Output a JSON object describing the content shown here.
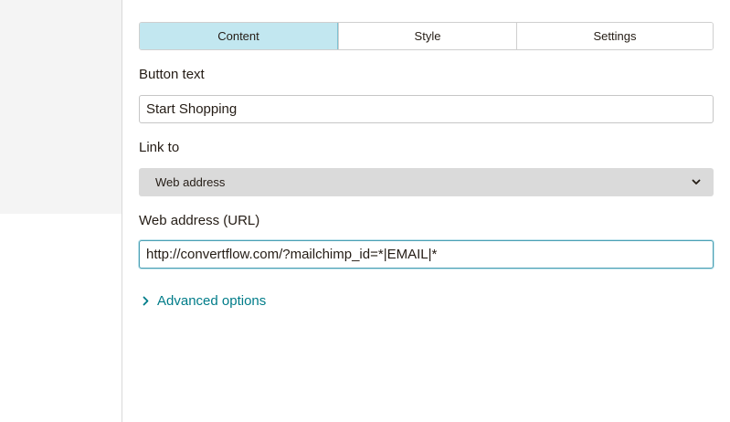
{
  "tabs": [
    {
      "label": "Content",
      "active": true
    },
    {
      "label": "Style",
      "active": false
    },
    {
      "label": "Settings",
      "active": false
    }
  ],
  "fields": {
    "button_text": {
      "label": "Button text",
      "value": "Start Shopping"
    },
    "link_to": {
      "label": "Link to",
      "selected": "Web address"
    },
    "url": {
      "label": "Web address (URL)",
      "value": "http://convertflow.com/?mailchimp_id=*|EMAIL|*"
    }
  },
  "advanced": {
    "label": "Advanced options"
  },
  "icons": {
    "select_chevron": "chevron-down-icon",
    "advanced_chevron": "chevron-right-icon"
  },
  "colors": {
    "active_tab_bg": "#c2e7f0",
    "link": "#007c89",
    "focus_border": "#4a9fb3"
  }
}
